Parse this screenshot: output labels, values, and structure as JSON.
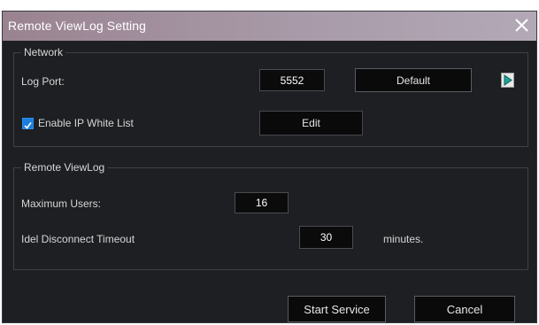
{
  "window": {
    "title": "Remote ViewLog Setting",
    "close_glyph": "✕",
    "close_icon": "close-icon"
  },
  "network": {
    "group_label": "Network",
    "log_port_label": "Log Port:",
    "log_port_value": "5552",
    "default_button": "Default",
    "arrow_icon": "play-arrow-icon",
    "whitelist_checked": true,
    "whitelist_label": "Enable IP White List",
    "edit_button": "Edit"
  },
  "remote_viewlog": {
    "group_label": "Remote ViewLog",
    "max_users_label": "Maximum Users:",
    "max_users_value": "16",
    "idle_timeout_label": "Idel Disconnect Timeout",
    "idle_timeout_value": "30",
    "idle_timeout_unit": "minutes."
  },
  "footer": {
    "start_button": "Start Service",
    "cancel_button": "Cancel"
  },
  "colors": {
    "background": "#1e1f22",
    "accent_checkbox": "#1c7fe0",
    "arrow_icon_fill": "#1aa59a"
  }
}
